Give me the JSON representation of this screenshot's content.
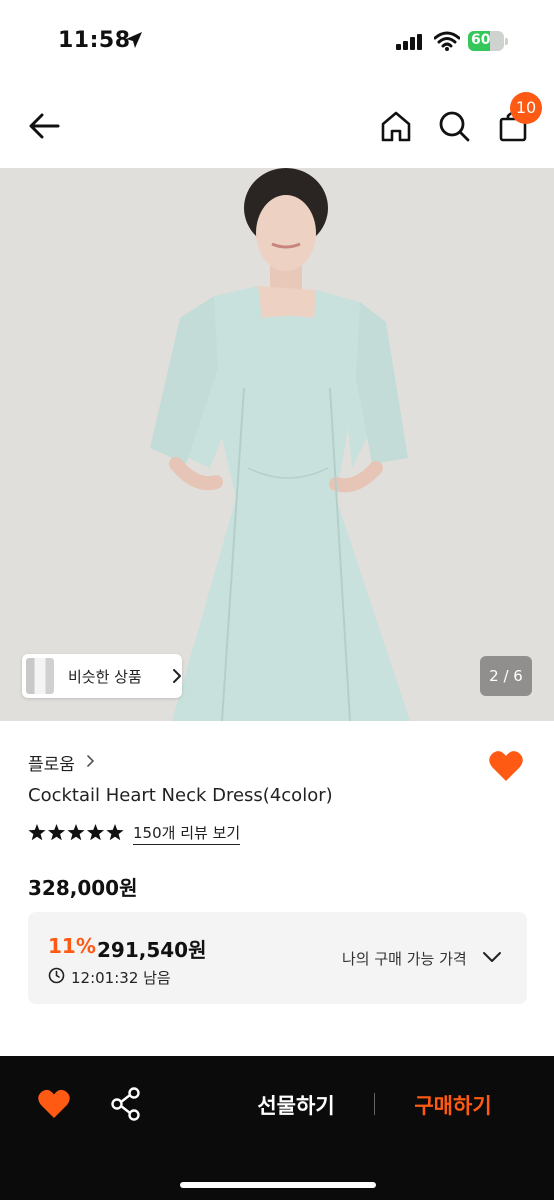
{
  "status_bar": {
    "time": "11:58",
    "battery_percent": "60",
    "battery_level": 0.6,
    "battery_color": "#35c759"
  },
  "nav": {
    "back_icon": "arrow-left-icon",
    "home_icon": "home-icon",
    "search_icon": "search-icon",
    "cart_icon": "shopping-bag-icon",
    "cart_count": "10"
  },
  "gallery": {
    "similar_label": "비슷한 상품",
    "page_indicator": "2 / 6"
  },
  "product": {
    "brand": "플로움",
    "title": "Cocktail Heart Neck Dress(4color)",
    "rating_stars": 5,
    "review_link": "150개 리뷰 보기",
    "original_price": "328,000원",
    "discount_rate": "11%",
    "discount_price": "291,540원",
    "time_remaining": "12:01:32 남음",
    "my_price_label": "나의 구매 가능 가격"
  },
  "bottom_bar": {
    "gift_label": "선물하기",
    "buy_label": "구매하기"
  },
  "colors": {
    "accent": "#ff5a14",
    "bottom_bar": "#0b0b0b"
  }
}
